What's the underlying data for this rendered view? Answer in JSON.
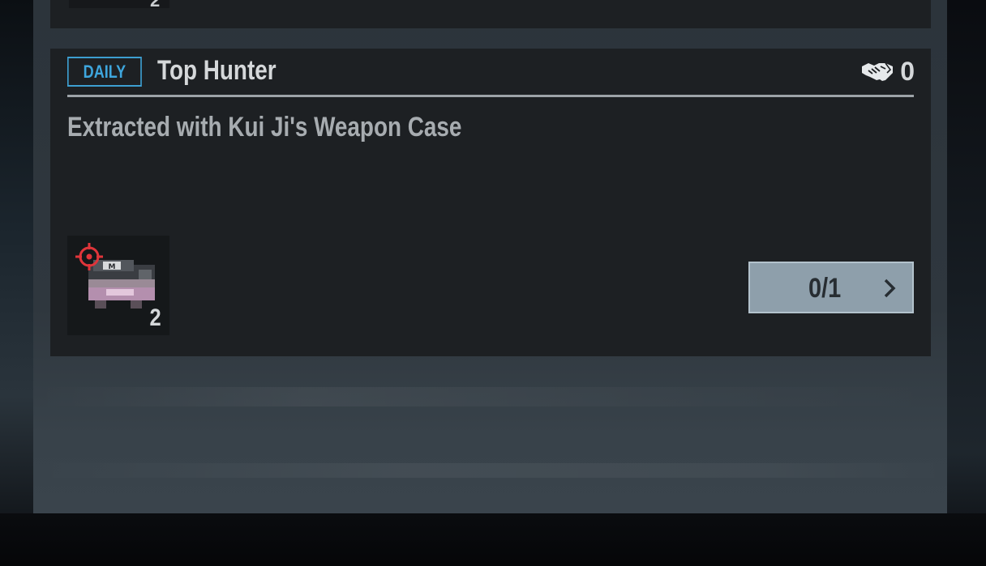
{
  "previous_card": {
    "item_count": "2"
  },
  "mission": {
    "badge": "DAILY",
    "title": "Top Hunter",
    "reward_icon": "handshake-icon",
    "reward_count": "0",
    "description": "Extracted with Kui Ji's Weapon Case",
    "reward_item": {
      "icon": "weapon-case-icon",
      "marker_icon": "crosshair-icon",
      "count": "2"
    },
    "progress": {
      "label": "0/1",
      "current": 0,
      "target": 1
    }
  },
  "colors": {
    "badge_accent": "#3ea6dd",
    "marker_red": "#e0353a",
    "progress_button": "#8e9fab",
    "card_bg": "#1d2023"
  }
}
